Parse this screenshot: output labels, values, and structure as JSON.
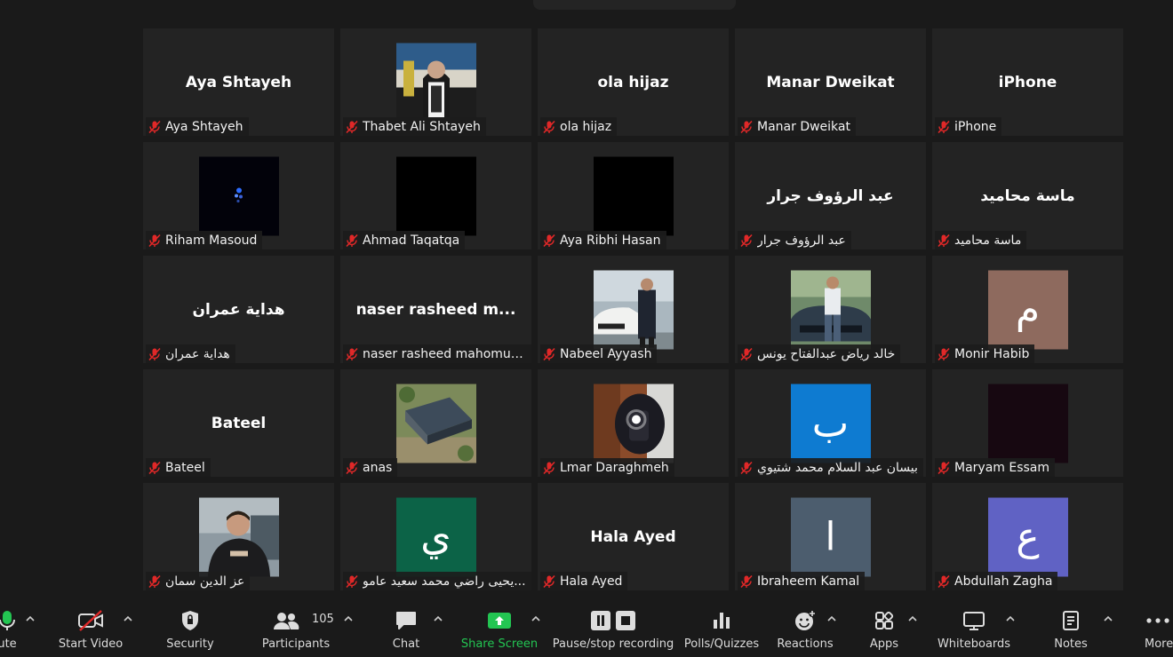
{
  "participants": [
    {
      "label": "Aya Shtayeh",
      "display": "Aya Shtayeh",
      "type": "name"
    },
    {
      "label": "Thabet Ali Shtayeh",
      "display": "",
      "type": "photo",
      "photo": "photo-flag"
    },
    {
      "label": "ola hijaz",
      "display": "ola hijaz",
      "type": "name"
    },
    {
      "label": "Manar Dweikat",
      "display": "Manar Dweikat",
      "type": "name"
    },
    {
      "label": "iPhone",
      "display": "iPhone",
      "type": "name"
    },
    {
      "label": "Riham Masoud",
      "display": "",
      "type": "photo",
      "photo": "photo-dark-sparkle"
    },
    {
      "label": "Ahmad Taqatqa",
      "display": "",
      "type": "box",
      "color": "#000000"
    },
    {
      "label": "Aya Ribhi Hasan",
      "display": "",
      "type": "box",
      "color": "#000000"
    },
    {
      "label": "عبد الرؤوف جرار",
      "display": "عبد الرؤوف جرار",
      "type": "name"
    },
    {
      "label": "ماسة محاميد",
      "display": "ماسة محاميد",
      "type": "name"
    },
    {
      "label": "هداية عمران",
      "display": "هداية عمران",
      "type": "name"
    },
    {
      "label": "naser rasheed mahomud k...",
      "display": "naser rasheed m...",
      "type": "name"
    },
    {
      "label": "Nabeel Ayyash",
      "display": "",
      "type": "photo",
      "photo": "photo-car-white"
    },
    {
      "label": "خالد رياض عبدالفتاح يونس",
      "display": "",
      "type": "photo",
      "photo": "photo-car-dark"
    },
    {
      "label": "Monir Habib",
      "display": "م",
      "type": "box",
      "color": "#8e6a5e"
    },
    {
      "label": "Bateel",
      "display": "Bateel",
      "type": "name"
    },
    {
      "label": "anas",
      "display": "",
      "type": "photo",
      "photo": "photo-aerial"
    },
    {
      "label": "Lmar Daraghmeh",
      "display": "",
      "type": "photo",
      "photo": "photo-selfie"
    },
    {
      "label": "بيسان عبد السلام محمد شتيوي",
      "display": "ب",
      "type": "box",
      "color": "#0e7bd1"
    },
    {
      "label": "Maryam Essam",
      "display": "",
      "type": "box",
      "color": "#170811"
    },
    {
      "label": "عز الدين سمان",
      "display": "",
      "type": "photo",
      "photo": "photo-man"
    },
    {
      "label": "يحيى راضي محمد سعيد عامو...",
      "display": "ي",
      "type": "box",
      "color": "#0c6347"
    },
    {
      "label": "Hala Ayed",
      "display": "Hala Ayed",
      "type": "name"
    },
    {
      "label": "Ibraheem Kamal",
      "display": "ا",
      "type": "box",
      "color": "#4c5d6e"
    },
    {
      "label": "Abdullah Zagha",
      "display": "ع",
      "type": "box",
      "color": "#6062c4"
    }
  ],
  "toolbar": {
    "mute_label": "ute",
    "start_video_label": "Start Video",
    "security_label": "Security",
    "participants_label": "Participants",
    "participants_count": "105",
    "chat_label": "Chat",
    "share_screen_label": "Share Screen",
    "recording_label": "Pause/stop recording",
    "polls_label": "Polls/Quizzes",
    "reactions_label": "Reactions",
    "apps_label": "Apps",
    "whiteboards_label": "Whiteboards",
    "notes_label": "Notes",
    "more_label": "More"
  },
  "colors": {
    "background": "#1a1a1a",
    "tile": "#232323",
    "muted_mic": "#e02828",
    "share_green": "#23c552"
  },
  "icons": {
    "mic": "muted-mic-icon",
    "mute": "microphone-icon",
    "video": "video-off-icon",
    "security": "shield-icon",
    "participants": "people-icon",
    "chat": "chat-bubble-icon",
    "share": "share-screen-icon",
    "record": "pause-stop-icon",
    "polls": "bar-chart-icon",
    "reactions": "smiley-plus-icon",
    "apps": "apps-icon",
    "whiteboards": "whiteboard-icon",
    "notes": "notes-icon",
    "more": "more-dots-icon"
  }
}
